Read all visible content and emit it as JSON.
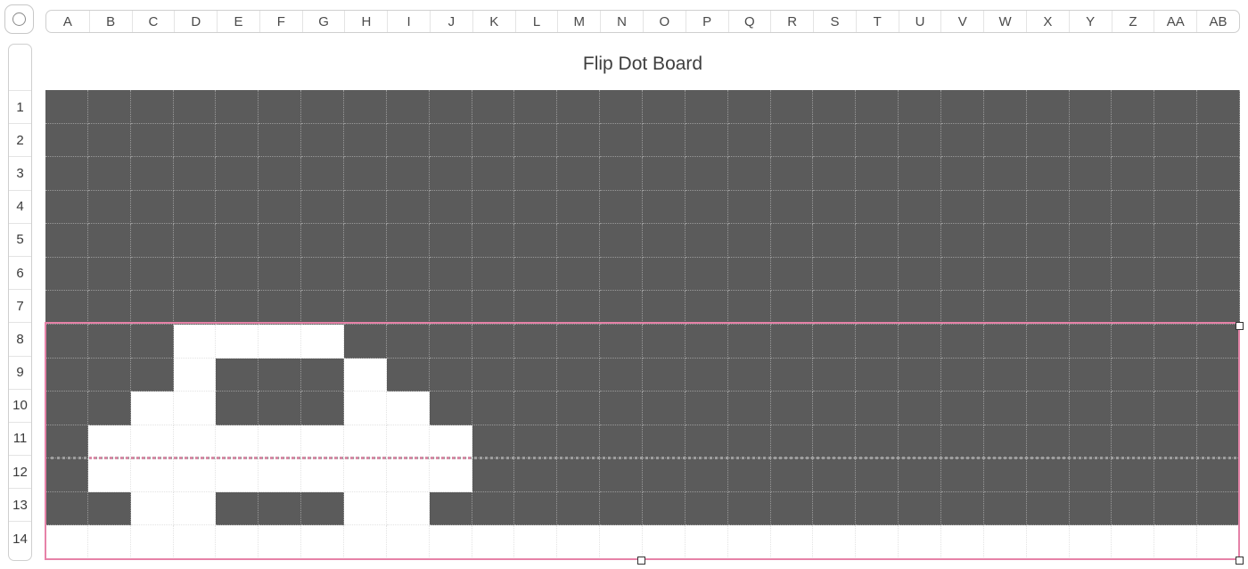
{
  "sheet": {
    "title": "Flip Dot Board",
    "columns": [
      "A",
      "B",
      "C",
      "D",
      "E",
      "F",
      "G",
      "H",
      "I",
      "J",
      "K",
      "L",
      "M",
      "N",
      "O",
      "P",
      "Q",
      "R",
      "S",
      "T",
      "U",
      "V",
      "W",
      "X",
      "Y",
      "Z",
      "AA",
      "AB"
    ],
    "rows": [
      "1",
      "2",
      "3",
      "4",
      "5",
      "6",
      "7",
      "8",
      "9",
      "10",
      "11",
      "12",
      "13",
      "14"
    ]
  },
  "board": {
    "on_color": "#ffffff",
    "off_color": "#5b5b5b",
    "selection_color": "#e682a8",
    "lit_cells": [
      [
        7,
        3
      ],
      [
        7,
        4
      ],
      [
        7,
        5
      ],
      [
        7,
        6
      ],
      [
        8,
        3
      ],
      [
        8,
        7
      ],
      [
        9,
        2
      ],
      [
        9,
        3
      ],
      [
        9,
        7
      ],
      [
        9,
        8
      ],
      [
        10,
        1
      ],
      [
        10,
        2
      ],
      [
        10,
        3
      ],
      [
        10,
        4
      ],
      [
        10,
        5
      ],
      [
        10,
        6
      ],
      [
        10,
        7
      ],
      [
        10,
        8
      ],
      [
        10,
        9
      ],
      [
        11,
        1
      ],
      [
        11,
        2
      ],
      [
        11,
        3
      ],
      [
        11,
        4
      ],
      [
        11,
        5
      ],
      [
        11,
        6
      ],
      [
        11,
        7
      ],
      [
        11,
        8
      ],
      [
        11,
        9
      ],
      [
        12,
        2
      ],
      [
        12,
        3
      ],
      [
        12,
        7
      ],
      [
        12,
        8
      ],
      [
        13,
        0
      ],
      [
        13,
        1
      ],
      [
        13,
        2
      ],
      [
        13,
        3
      ],
      [
        13,
        4
      ],
      [
        13,
        5
      ],
      [
        13,
        6
      ],
      [
        13,
        7
      ],
      [
        13,
        8
      ],
      [
        13,
        9
      ],
      [
        13,
        10
      ],
      [
        13,
        11
      ],
      [
        13,
        12
      ],
      [
        13,
        13
      ],
      [
        13,
        14
      ],
      [
        13,
        15
      ],
      [
        13,
        16
      ],
      [
        13,
        17
      ],
      [
        13,
        18
      ],
      [
        13,
        19
      ],
      [
        13,
        20
      ],
      [
        13,
        21
      ],
      [
        13,
        22
      ],
      [
        13,
        23
      ],
      [
        13,
        24
      ],
      [
        13,
        25
      ],
      [
        13,
        26
      ],
      [
        13,
        27
      ]
    ]
  }
}
